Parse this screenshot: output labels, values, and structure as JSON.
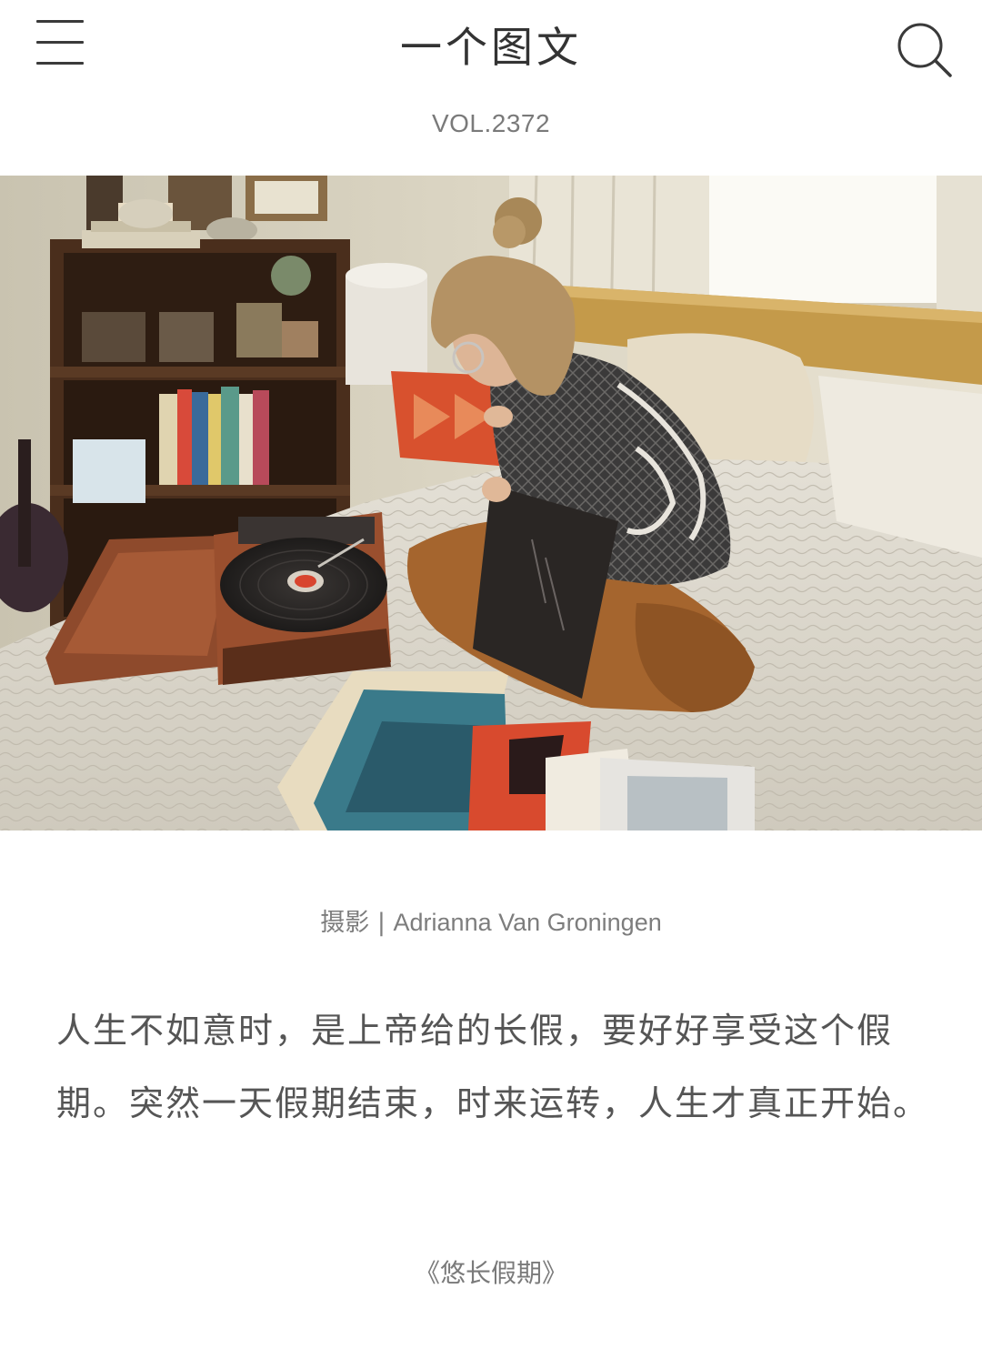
{
  "header": {
    "title": "一个图文",
    "menu_icon": "hamburger-menu-icon",
    "search_icon": "search-icon"
  },
  "article": {
    "volume": "VOL.2372",
    "photo_credit_label": "摄影 | ",
    "photo_credit_name": "Adrianna Van Groningen",
    "quote": "人生不如意时，是上帝给的长假，要好好享受这个假期。突然一天假期结束，时来运转，人生才真正开始。",
    "source": "《悠长假期》"
  },
  "colors": {
    "text_primary": "#333333",
    "text_secondary": "#7a7a7a",
    "background": "#ffffff"
  }
}
